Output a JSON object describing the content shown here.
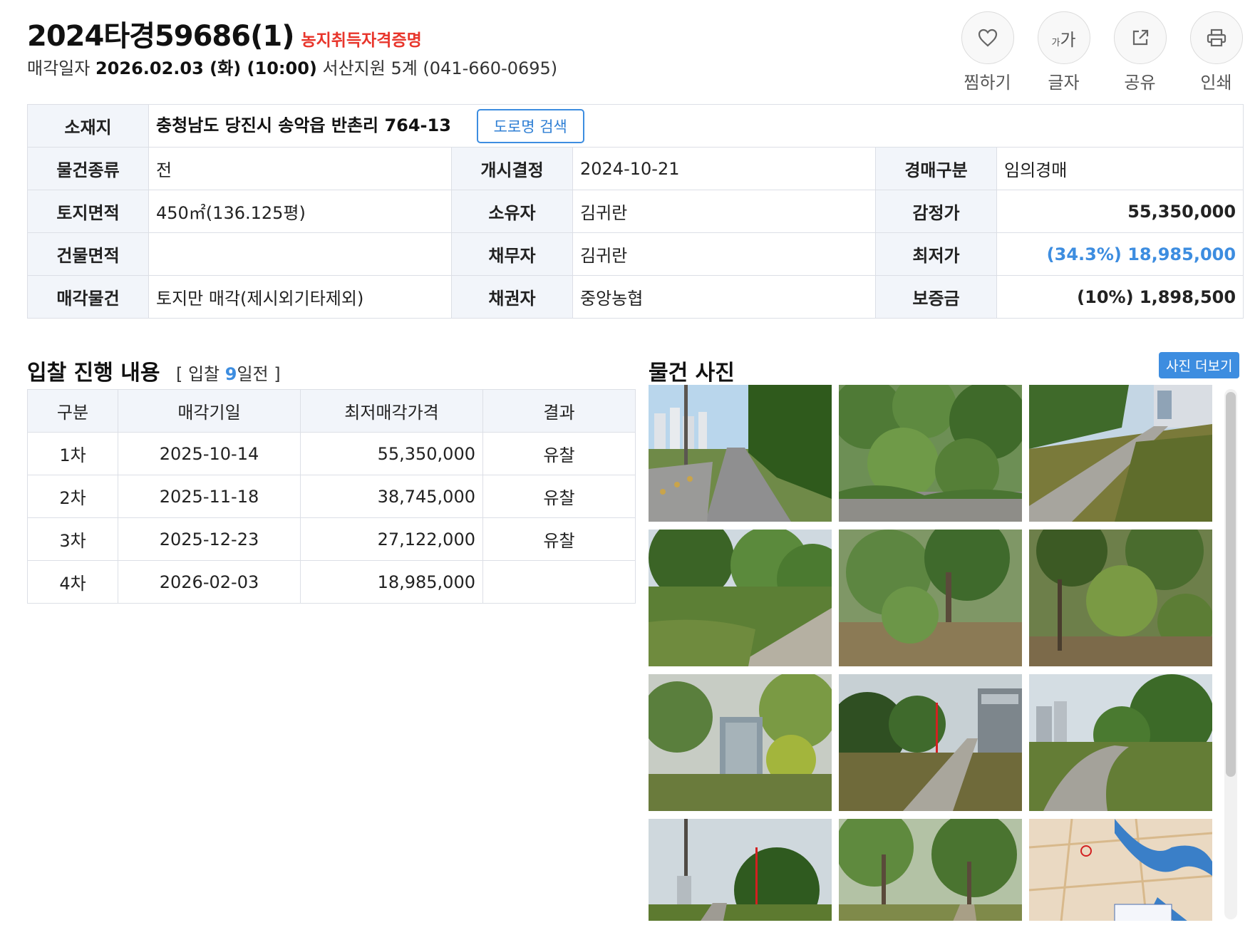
{
  "header": {
    "case_no": "2024타경59686(1)",
    "farm_cert": "농지취득자격증명",
    "sale_label": "매각일자",
    "sale_date": "2026.02.03 (화) (10:00)",
    "court": "서산지원 5계 (041-660-0695)"
  },
  "tools": [
    {
      "label": "찜하기",
      "icon": "heart-icon"
    },
    {
      "label": "글자",
      "icon": "font-size-icon",
      "glyph_small": "가",
      "glyph_big": "가"
    },
    {
      "label": "공유",
      "icon": "share-icon"
    },
    {
      "label": "인쇄",
      "icon": "print-icon"
    }
  ],
  "info": {
    "location_label": "소재지",
    "location": "충청남도 당진시 송악읍 반촌리 764-13",
    "road_button": "도로명 검색",
    "rows": [
      {
        "k1": "물건종류",
        "v1": "전",
        "k2": "개시결정",
        "v2": "2024-10-21",
        "k3": "경매구분",
        "v3": "임의경매"
      },
      {
        "k1": "토지면적",
        "v1": "450㎡(136.125평)",
        "k2": "소유자",
        "v2": "김귀란",
        "k3": "감정가",
        "v3": "55,350,000"
      },
      {
        "k1": "건물면적",
        "v1": "",
        "k2": "채무자",
        "v2": "김귀란",
        "k3": "최저가",
        "v3": "(34.3%) 18,985,000"
      },
      {
        "k1": "매각물건",
        "v1": "토지만 매각(제시외기타제외)",
        "k2": "채권자",
        "v2": "중앙농협",
        "k3": "보증금",
        "v3": "(10%) 1,898,500"
      }
    ]
  },
  "bid": {
    "title": "입찰 진행 내용",
    "sub_prefix": "[ 입찰 ",
    "days": "9",
    "sub_suffix": "일전 ]",
    "headers": [
      "구분",
      "매각기일",
      "최저매각가격",
      "결과"
    ],
    "rows": [
      {
        "round": "1차",
        "date": "2025-10-14",
        "price": "55,350,000",
        "result": "유찰"
      },
      {
        "round": "2차",
        "date": "2025-11-18",
        "price": "38,745,000",
        "result": "유찰"
      },
      {
        "round": "3차",
        "date": "2025-12-23",
        "price": "27,122,000",
        "result": "유찰"
      },
      {
        "round": "4차",
        "date": "2026-02-03",
        "price": "18,985,000",
        "result": ""
      }
    ]
  },
  "photos": {
    "title": "물건 사진",
    "more_button": "사진 더보기",
    "count": 12
  },
  "colors": {
    "accent": "#3d8de0",
    "alert": "#e8352b",
    "header_bg": "#f2f5fa",
    "border": "#dcdfe6"
  }
}
